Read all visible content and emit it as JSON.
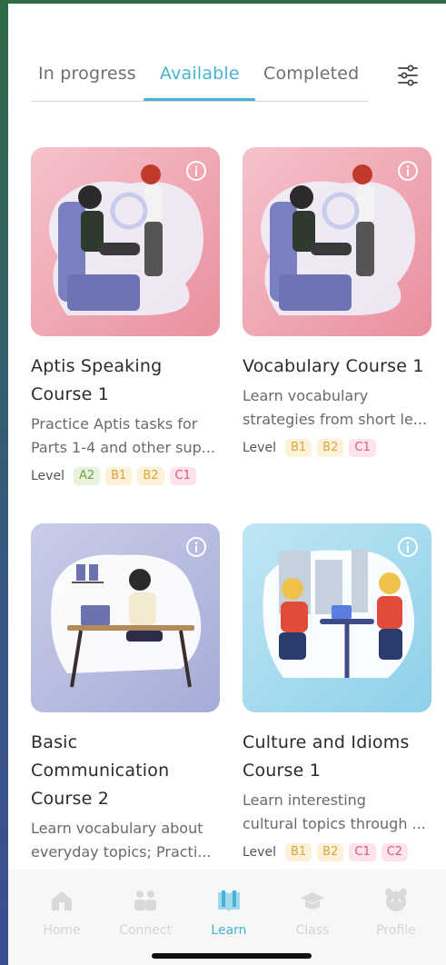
{
  "tabs": [
    {
      "label": "In progress"
    },
    {
      "label": "Available",
      "active": true
    },
    {
      "label": "Completed"
    }
  ],
  "filter_icon": "sliders-icon",
  "level_label": "Level",
  "courses": [
    {
      "title_lines": [
        "Aptis Speaking",
        "Course 1"
      ],
      "desc_lines": [
        "Practice Aptis tasks for",
        "Parts 1-4 and other sup..."
      ],
      "levels": [
        "A2",
        "B1",
        "B2",
        "C1"
      ],
      "theme": "pink"
    },
    {
      "title_lines": [
        "Vocabulary Course 1"
      ],
      "desc_lines": [
        "Learn vocabulary",
        "strategies from short le..."
      ],
      "levels": [
        "B1",
        "B2",
        "C1"
      ],
      "theme": "pink"
    },
    {
      "title_lines": [
        "Basic",
        "Communication",
        "Course 2"
      ],
      "desc_lines": [
        "Learn vocabulary about",
        "everyday topics; Practi..."
      ],
      "levels": [],
      "theme": "lavender"
    },
    {
      "title_lines": [
        "Culture and Idioms",
        "Course 1"
      ],
      "desc_lines": [
        "Learn interesting",
        "cultural topics through ..."
      ],
      "levels": [
        "B1",
        "B2",
        "C1",
        "C2"
      ],
      "theme": "blue"
    }
  ],
  "nav": [
    {
      "label": "Home",
      "icon": "home-icon"
    },
    {
      "label": "Connect",
      "icon": "people-icon"
    },
    {
      "label": "Learn",
      "icon": "book-icon",
      "active": true
    },
    {
      "label": "Class",
      "icon": "graduation-cap-icon"
    },
    {
      "label": "Profile",
      "icon": "profile-face-icon"
    }
  ],
  "colors": {
    "accent": "#45b3d3",
    "pink_card": "#f1a9b4",
    "lavender_card": "#b7bde3",
    "blue_card": "#a9dcef"
  }
}
